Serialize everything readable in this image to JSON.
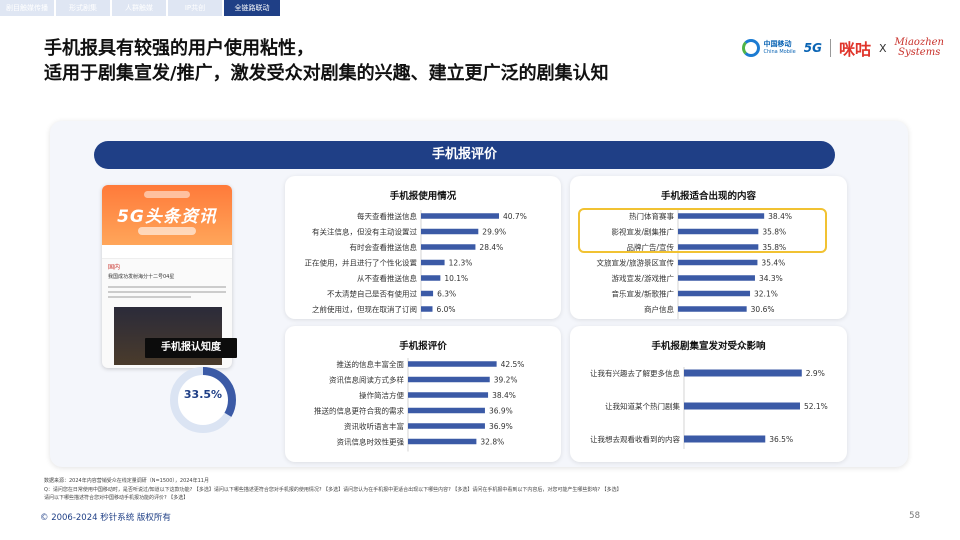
{
  "tabs": [
    "剧目触媒传播",
    "形式剧集",
    "人群触媒",
    "IP共创",
    "全链路联动"
  ],
  "title_line1": "手机报具有较强的用户使用粘性，",
  "title_line2": "适用于剧集宣发/推广，激发受众对剧集的兴趣、建立更广泛的剧集认知",
  "logos": {
    "cm_cn": "中国移动",
    "cm_en": "China Mobile",
    "fiveg": "5G",
    "migu": "咪咕",
    "x": "X",
    "miaozhen_1": "Miaozhen",
    "miaozhen_2": "Systems"
  },
  "banner": "手机报评价",
  "phone": {
    "headline": "5G头条资讯",
    "category": "国内",
    "news": "我国成功发射海分十二号04星",
    "awareness_label": "手机报认知度"
  },
  "awareness": {
    "value": 33.5,
    "display": "33.5%"
  },
  "colors": {
    "bar": "#3b5aa6",
    "navy": "#1f3f86",
    "highlight": "#f1c232",
    "donut_track": "#dbe4f3"
  },
  "chart_data": [
    {
      "type": "bar",
      "orientation": "horizontal",
      "title": "手机报使用情况",
      "categories": [
        "每天查看推送信息",
        "有关注信息，但没有主动设置过",
        "有时会查看推送信息",
        "正在使用，并且进行了个性化设置",
        "从不查看推送信息",
        "不太清楚自己是否有使用过",
        "之前使用过，但现在取消了订阅"
      ],
      "values": [
        40.7,
        29.9,
        28.4,
        12.3,
        10.1,
        6.3,
        6.0
      ],
      "labels": [
        "40.7%",
        "29.9%",
        "28.4%",
        "12.3%",
        "10.1%",
        "6.3%",
        "6.0%"
      ],
      "xlim": [
        0,
        48
      ]
    },
    {
      "type": "bar",
      "orientation": "horizontal",
      "title": "手机报适合出现的内容",
      "categories": [
        "热门体育赛事",
        "影视宣发/剧集推广",
        "品牌广告/宣传",
        "文旅宣发/旅游景区宣传",
        "游戏宣发/游戏推广",
        "音乐宣发/新歌推广",
        "商户信息"
      ],
      "values": [
        38.4,
        35.8,
        35.8,
        35.4,
        34.3,
        32.1,
        30.6
      ],
      "labels": [
        "38.4%",
        "35.8%",
        "35.8%",
        "35.4%",
        "34.3%",
        "32.1%",
        "30.6%"
      ],
      "xlim": [
        0,
        41
      ]
    },
    {
      "type": "bar",
      "orientation": "horizontal",
      "title": "手机报评价",
      "categories": [
        "推送的信息丰富全面",
        "资讯信息阅读方式多样",
        "操作简洁方便",
        "推送的信息更符合我的需求",
        "资讯收听语言丰富",
        "资讯信息时效性更强"
      ],
      "values": [
        42.5,
        39.2,
        38.4,
        36.9,
        36.9,
        32.8
      ],
      "labels": [
        "42.5%",
        "39.2%",
        "38.4%",
        "36.9%",
        "36.9%",
        "32.8%"
      ],
      "xlim": [
        0,
        47
      ]
    },
    {
      "type": "bar",
      "orientation": "horizontal",
      "title": "手机报剧集宣发对受众影响",
      "categories": [
        "让我有兴趣去了解更多信息",
        "让我知道某个热门剧集",
        "让我想去观看收看到的内容"
      ],
      "values": [
        52.9,
        52.1,
        36.5
      ],
      "labels": [
        "2.9%",
        "52.1%",
        "36.5%"
      ],
      "xlim": [
        0,
        53
      ]
    }
  ],
  "footnote_lines": [
    "数据来源：2024年内容营销受众在线定量调研（N=1500），2024年11月",
    "Q：请问您在日常使用中国移动时，是否听说过/知道以下这款功能?  【多选】请问以下哪些描述更符合您对手机报的使用情况?  【多选】请问您认为在手机报中更适合出现以下哪些内容?  【多选】请问在手机报中看到以下内容后，对您可能产生哪些影响?  【多选】",
    "请问以下哪些描述符合您对中国移动手机报功能的评价?  【多选】"
  ],
  "copyright": "© 2006-2024 秒针系统 版权所有",
  "page_number": "58"
}
